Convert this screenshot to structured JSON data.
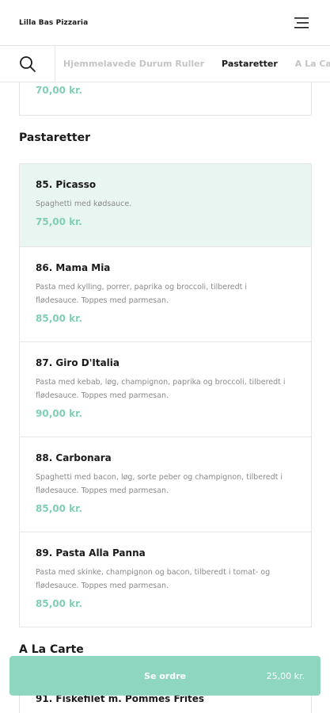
{
  "header": {
    "brand": "Lilla Bas Pizzaria"
  },
  "categories": [
    {
      "label": "Hjemmelavede Durum Ruller",
      "active": false
    },
    {
      "label": "Pastaretter",
      "active": true
    },
    {
      "label": "A La Carte",
      "active": false
    }
  ],
  "prev_item": {
    "price": "70,00 kr."
  },
  "sections": [
    {
      "title": "Pastaretter",
      "items": [
        {
          "name": "85. Picasso",
          "desc": "Spaghetti med kødsauce.",
          "price": "75,00 kr."
        },
        {
          "name": "86. Mama Mia",
          "desc": "Pasta med kylling, porrer, paprika og broccoli, tilberedt i flødesauce. Toppes med parmesan.",
          "price": "85,00 kr."
        },
        {
          "name": "87. Giro D'Italia",
          "desc": "Pasta med kebab, løg, champignon, paprika og broccoli, tilberedt i flødesauce. Toppes med parmesan.",
          "price": "90,00 kr."
        },
        {
          "name": "88. Carbonara",
          "desc": "Spaghetti med bacon, løg, sorte peber og champignon, tilberedt i flødesauce. Toppes med parmesan.",
          "price": "85,00 kr."
        },
        {
          "name": "89. Pasta Alla Panna",
          "desc": "Pasta med skinke, champignon og bacon, tilberedt i tomat- og flødesauce. Toppes med parmesan.",
          "price": "85,00 kr."
        }
      ]
    },
    {
      "title": "A La Carte",
      "items": [
        {
          "name": "91. Fiskefilet m. Pommes Frites"
        }
      ]
    }
  ],
  "order_bar": {
    "label": "Se ordre",
    "total": "25,00 kr."
  },
  "colors": {
    "accent": "#8fd6c0",
    "price": "#7fcfb6",
    "highlight": "#e9f5f1"
  }
}
